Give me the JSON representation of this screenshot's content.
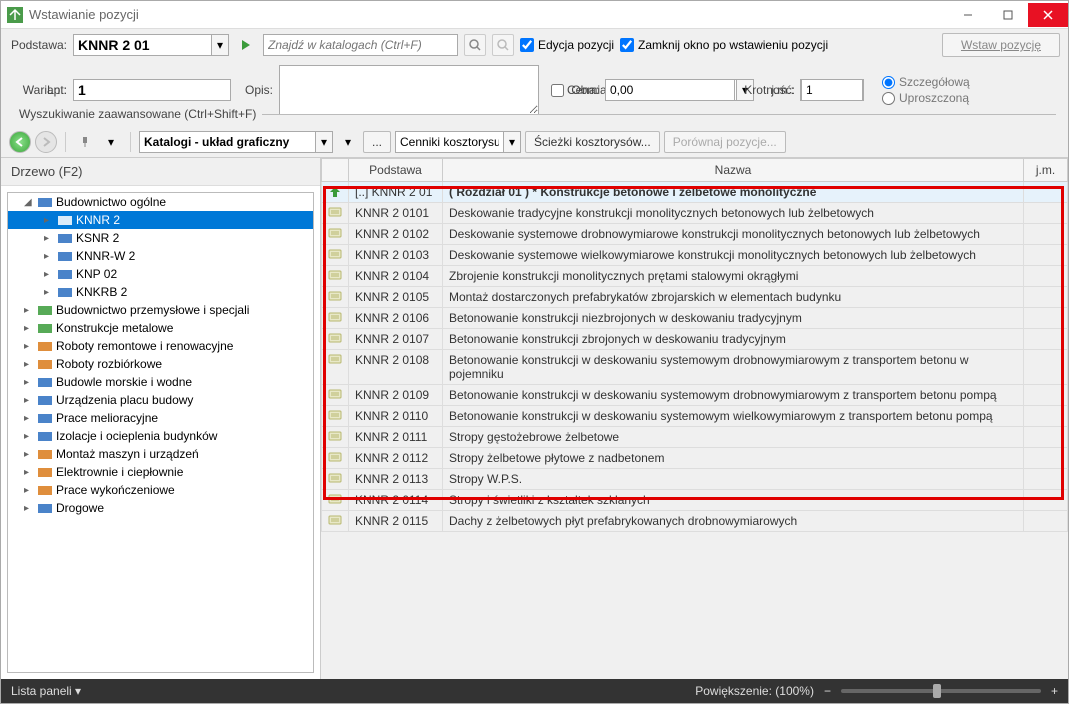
{
  "window": {
    "title": "Wstawianie pozycji"
  },
  "form": {
    "podstawa_label": "Podstawa:",
    "podstawa_value": "KNNR 2 01",
    "wariant_label": "Wariant:",
    "lp_label": "Lp.:",
    "lp_value": "1",
    "opis_label": "Opis:",
    "search_placeholder": "Znajdź w katalogach (Ctrl+F)",
    "edycja_label": "Edycja pozycji",
    "zamknij_label": "Zamknij okno po wstawieniu pozycji",
    "obmiar_label": "Obmiar:",
    "jm_label": "j.m.:",
    "cena_label": "Cena:",
    "cena_value": "0,00",
    "krotnosc_label": "Krotność:",
    "krotnosc_value": "1",
    "wstaw_btn": "Wstaw pozycję",
    "radio_szcz": "Szczegółową",
    "radio_upr": "Uproszczoną",
    "adv_search": "Wyszukiwanie zaawansowane (Ctrl+Shift+F)"
  },
  "toolbar": {
    "view_select": "Katalogi - układ graficzny",
    "cenniki": "Cenniki kosztorysu",
    "sciezki": "Ścieżki kosztorysów...",
    "porownaj": "Porównaj pozycje..."
  },
  "tree": {
    "title": "Drzewo (F2)",
    "items": [
      {
        "lvl": 0,
        "exp": "◢",
        "ico": "building-blue",
        "label": "Budownictwo ogólne"
      },
      {
        "lvl": 1,
        "exp": "▸",
        "ico": "book-blue",
        "label": "KNNR 2",
        "sel": true
      },
      {
        "lvl": 1,
        "exp": "▸",
        "ico": "book-blue",
        "label": "KSNR 2"
      },
      {
        "lvl": 1,
        "exp": "▸",
        "ico": "book-blue",
        "label": "KNNR-W 2"
      },
      {
        "lvl": 1,
        "exp": "▸",
        "ico": "book-blue",
        "label": "KNP 02"
      },
      {
        "lvl": 1,
        "exp": "▸",
        "ico": "book-blue",
        "label": "KNKRB 2"
      },
      {
        "lvl": 0,
        "exp": "▸",
        "ico": "factory-green",
        "label": "Budownictwo przemysłowe i specjali"
      },
      {
        "lvl": 0,
        "exp": "▸",
        "ico": "grid-green",
        "label": "Konstrukcje metalowe"
      },
      {
        "lvl": 0,
        "exp": "▸",
        "ico": "worker-orange",
        "label": "Roboty remontowe i renowacyjne"
      },
      {
        "lvl": 0,
        "exp": "▸",
        "ico": "pick-orange",
        "label": "Roboty rozbiórkowe"
      },
      {
        "lvl": 0,
        "exp": "▸",
        "ico": "ship-blue",
        "label": "Budowle morskie i wodne"
      },
      {
        "lvl": 0,
        "exp": "▸",
        "ico": "crane-blue",
        "label": "Urządzenia placu budowy"
      },
      {
        "lvl": 0,
        "exp": "▸",
        "ico": "cart-blue",
        "label": "Prace melioracyjne"
      },
      {
        "lvl": 0,
        "exp": "▸",
        "ico": "house-blue",
        "label": "Izolacje i ocieplenia budynków"
      },
      {
        "lvl": 0,
        "exp": "▸",
        "ico": "wrench-orange",
        "label": "Montaż maszyn i urządzeń"
      },
      {
        "lvl": 0,
        "exp": "▸",
        "ico": "bolt-orange",
        "label": "Elektrownie i ciepłownie"
      },
      {
        "lvl": 0,
        "exp": "▸",
        "ico": "brush-orange",
        "label": "Prace wykończeniowe"
      },
      {
        "lvl": 0,
        "exp": "▸",
        "ico": "road-blue",
        "label": "Drogowe"
      }
    ]
  },
  "table": {
    "cols": {
      "podstawa": "Podstawa",
      "nazwa": "Nazwa",
      "jm": "j.m."
    },
    "rows": [
      {
        "hdr": true,
        "code": "[..] KNNR 2 01",
        "name": "( Rozdział 01 ) * Konstrukcje betonowe i żelbetowe monolityczne"
      },
      {
        "code": "KNNR 2 0101",
        "name": "Deskowanie tradycyjne konstrukcji monolitycznych betonowych lub żelbetowych"
      },
      {
        "code": "KNNR 2 0102",
        "name": "Deskowanie systemowe drobnowymiarowe konstrukcji monolitycznych betonowych lub żelbetowych"
      },
      {
        "code": "KNNR 2 0103",
        "name": "Deskowanie systemowe wielkowymiarowe konstrukcji monolitycznych betonowych lub żelbetowych"
      },
      {
        "code": "KNNR 2 0104",
        "name": "Zbrojenie konstrukcji monolitycznych prętami stalowymi okrągłymi"
      },
      {
        "code": "KNNR 2 0105",
        "name": "Montaż dostarczonych prefabrykatów zbrojarskich w elementach budynku"
      },
      {
        "code": "KNNR 2 0106",
        "name": "Betonowanie konstrukcji niezbrojonych w deskowaniu tradycyjnym"
      },
      {
        "code": "KNNR 2 0107",
        "name": "Betonowanie konstrukcji zbrojonych w deskowaniu tradycyjnym"
      },
      {
        "code": "KNNR 2 0108",
        "name": "Betonowanie konstrukcji w deskowaniu systemowym drobnowymiarowym z transportem betonu w pojemniku"
      },
      {
        "code": "KNNR 2 0109",
        "name": "Betonowanie konstrukcji w deskowaniu systemowym drobnowymiarowym z transportem betonu pompą"
      },
      {
        "code": "KNNR 2 0110",
        "name": "Betonowanie konstrukcji w deskowaniu systemowym wielkowymiarowym z transportem betonu pompą"
      },
      {
        "code": "KNNR 2 0111",
        "name": "Stropy gęstożebrowe żelbetowe"
      },
      {
        "code": "KNNR 2 0112",
        "name": "Stropy żelbetowe płytowe z nadbetonem"
      },
      {
        "code": "KNNR 2 0113",
        "name": "Stropy W.P.S."
      },
      {
        "code": "KNNR 2 0114",
        "name": "Stropy i świetliki z kształtek szklanych"
      },
      {
        "code": "KNNR 2 0115",
        "name": "Dachy z żelbetowych płyt prefabrykowanych drobnowymiarowych"
      }
    ]
  },
  "status": {
    "lista": "Lista paneli",
    "zoom": "Powiększenie: (100%)"
  }
}
